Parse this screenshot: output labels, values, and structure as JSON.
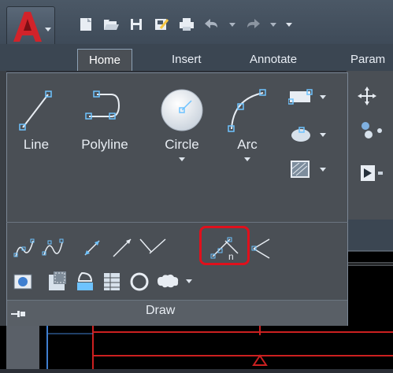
{
  "tabs": [
    {
      "label": "Home",
      "active": true
    },
    {
      "label": "Insert"
    },
    {
      "label": "Annotate"
    },
    {
      "label": "Param"
    }
  ],
  "panel": {
    "title": "Draw",
    "tools_large": [
      {
        "label": "Line"
      },
      {
        "label": "Polyline"
      },
      {
        "label": "Circle"
      },
      {
        "label": "Arc"
      }
    ]
  },
  "colors": {
    "highlight": "#e0101c",
    "ribbon": "#4a4f55",
    "tab_bar": "#3b4652",
    "autocad_red": "#c8232c"
  }
}
